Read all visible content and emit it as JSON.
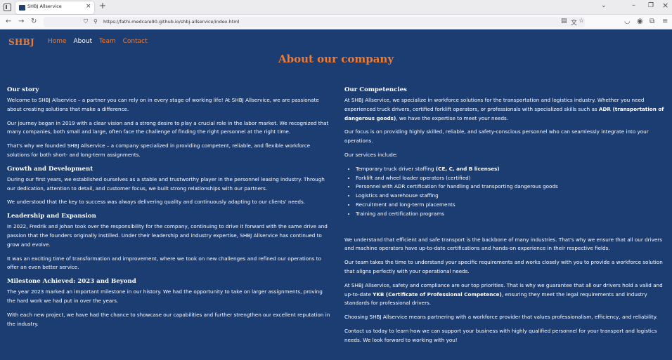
{
  "browser": {
    "tab_title": "SHBJ Allservice",
    "tab_close": "×",
    "new_tab": "+",
    "url": "https://fathi.medcare90.github.io/shbj-allservice/index.html"
  },
  "nav": {
    "brand": "SHBJ",
    "links": [
      "Home",
      "About",
      "Team",
      "Contact"
    ]
  },
  "page_title": "About our company",
  "left": {
    "story": {
      "title": "Our story",
      "p1": "Welcome to SHBJ Allservice – a partner you can rely on in every stage of working life! At SHBJ Allservice, we are passionate about creating solutions that make a difference.",
      "p2": "Our journey began in 2019 with a clear vision and a strong desire to play a crucial role in the labor market. We recognized that many companies, both small and large, often face the challenge of finding the right personnel at the right time.",
      "p3": "That's why we founded SHBJ Allservice – a company specialized in providing competent, reliable, and flexible workforce solutions for both short- and long-term assignments."
    },
    "growth": {
      "title": "Growth and Development",
      "p1": "During our first years, we established ourselves as a stable and trustworthy player in the personnel leasing industry. Through our dedication, attention to detail, and customer focus, we built strong relationships with our partners.",
      "p2": "We understood that the key to success was always delivering quality and continuously adapting to our clients' needs."
    },
    "leadership": {
      "title": "Leadership and Expansion",
      "p1": "In 2022, Fredrik and Johan took over the responsibility for the company, continuing to drive it forward with the same drive and passion that the founders originally instilled. Under their leadership and industry expertise, SHBJ Allservice has continued to grow and evolve.",
      "p2": "It was an exciting time of transformation and improvement, where we took on new challenges and refined our operations to offer an even better service."
    },
    "milestone": {
      "title": "Milestone Achieved: 2023 and Beyond",
      "p1": "The year 2023 marked an important milestone in our history. We had the opportunity to take on larger assignments, proving the hard work we had put in over the years.",
      "p2": "With each new project, we have had the chance to showcase our capabilities and further strengthen our excellent reputation in the industry."
    }
  },
  "right": {
    "title": "Our Competencies",
    "p1_a": "At SHBJ Allservice, we specialize in workforce solutions for the transportation and logistics industry. Whether you need experienced truck drivers, certified forklift operators, or professionals with specialized skills such as ",
    "p1_b": "ADR (transportation of dangerous goods)",
    "p1_c": ", we have the expertise to meet your needs.",
    "p2": "Our focus is on providing highly skilled, reliable, and safety-conscious personnel who can seamlessly integrate into your operations.",
    "p3": "Our services include:",
    "services": [
      {
        "a": "Temporary truck driver staffing ",
        "b": "(CE, C, and B licenses)"
      },
      {
        "a": "Forklift and wheel loader operators (certified)",
        "b": ""
      },
      {
        "a": "Personnel with ADR certification for handling and transporting dangerous goods",
        "b": ""
      },
      {
        "a": "Logistics and warehouse staffing",
        "b": ""
      },
      {
        "a": "Recruitment and long-term placements",
        "b": ""
      },
      {
        "a": "Training and certification programs",
        "b": ""
      }
    ],
    "p4": "We understand that efficient and safe transport is the backbone of many industries. That's why we ensure that all our drivers and machine operators have up-to-date certifications and hands-on experience in their respective fields.",
    "p5": "Our team takes the time to understand your specific requirements and works closely with you to provide a workforce solution that aligns perfectly with your operational needs.",
    "p6_a": "At SHBJ Allservice, safety and compliance are our top priorities. That is why we guarantee that all our drivers hold a valid and up-to-date ",
    "p6_b": "YKB (Certificate of Professional Competence)",
    "p6_c": ", ensuring they meet the legal requirements and industry standards for professional drivers.",
    "p7": "Choosing SHBJ Allservice means partnering with a workforce provider that values professionalism, efficiency, and reliability.",
    "p8": "Contact us today to learn how we can support your business with highly qualified personnel for your transport and logistics needs. We look forward to working with you!"
  }
}
